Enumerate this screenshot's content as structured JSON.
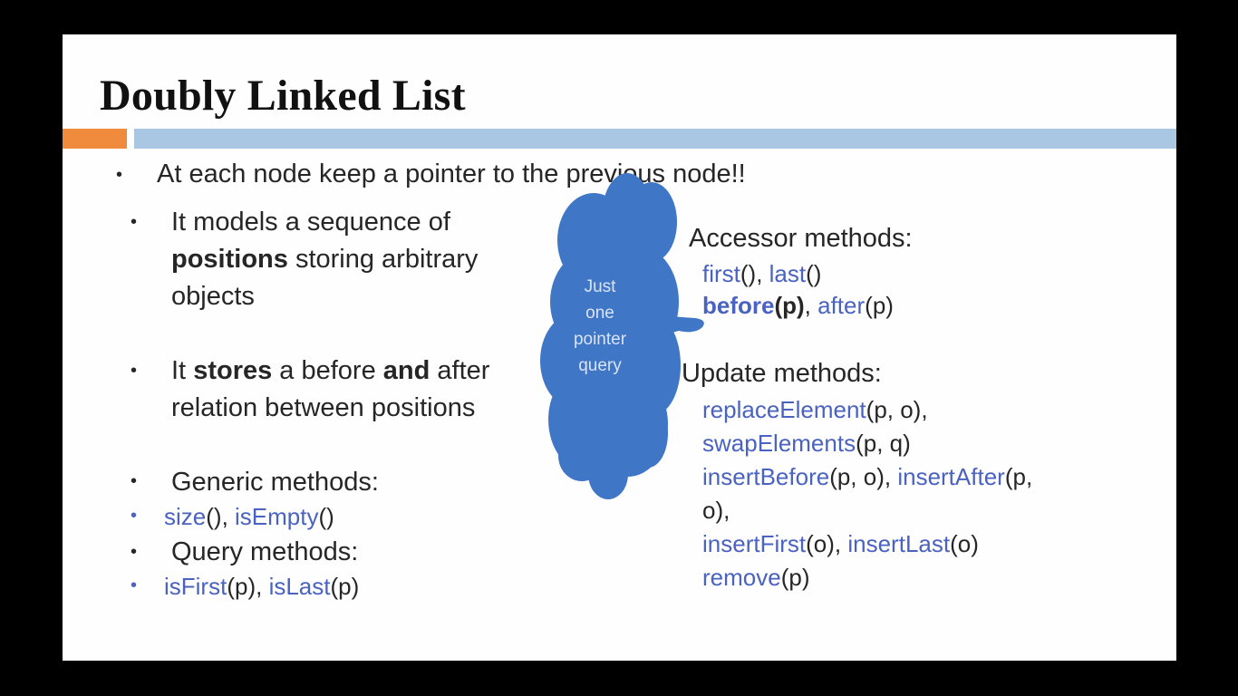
{
  "slide": {
    "title": "Doubly Linked List",
    "main_bullet": "At each node keep a pointer to the previous node!!",
    "left": {
      "b1": {
        "pre": "It models a sequence of",
        "bold": "positions",
        "post": "storing arbitrary",
        "line3": "objects"
      },
      "b2": {
        "w1": "It",
        "w2": "stores",
        "w3": "a before",
        "w4": "and",
        "w5": "after",
        "line2": "relation between positions"
      },
      "generic_label": "Generic methods:",
      "generic": {
        "m1": "size",
        "a1": "(), ",
        "m2": "isEmpty",
        "a2": "()"
      },
      "query_label": "Query methods:",
      "query": {
        "m1": "isFirst",
        "a1": "(p), ",
        "m2": "isLast",
        "a2": "(p)"
      }
    },
    "callout": {
      "line1": "Just",
      "line2": "one",
      "line3": "pointer",
      "line4": "query"
    },
    "right": {
      "accessor_label": "Accessor methods:",
      "acc1": {
        "m1": "first",
        "a1": "(), ",
        "m2": "last",
        "a2": "()"
      },
      "acc2": {
        "m1": "before",
        "a1": "(p)",
        "sep": ", ",
        "m2": "after",
        "a2": "(p)"
      },
      "update_label": "Update methods:",
      "u1": {
        "m": "replaceElement",
        "a": "(p, o),"
      },
      "u2": {
        "m": "swapElements",
        "a": "(p, q)"
      },
      "u3": {
        "m1": "insertBefore",
        "a1": "(p, o), ",
        "m2": "insertAfter",
        "a2": "(p,"
      },
      "u3b": "o),",
      "u4": {
        "m1": "insertFirst",
        "a1": "(o), ",
        "m2": "insertLast",
        "a2": "(o)"
      },
      "u5": {
        "m": "remove",
        "a": "(p)"
      }
    }
  },
  "colors": {
    "background": "#000000",
    "slide": "#fefefe",
    "accent_orange": "#f08a3c",
    "accent_blue": "#a9c6e2",
    "method_blue": "#4a62c0",
    "cloud": "#3f77c6"
  }
}
